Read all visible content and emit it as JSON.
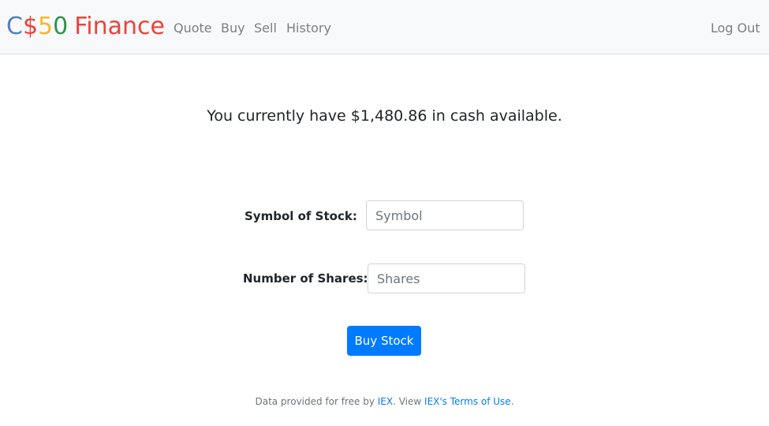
{
  "brand": {
    "c": "C",
    "dollar": "$",
    "five": "5",
    "zero": "0",
    "finance": "Finance"
  },
  "nav": {
    "quote": "Quote",
    "buy": "Buy",
    "sell": "Sell",
    "history": "History",
    "logout": "Log Out"
  },
  "cash_message": "You currently have $1,480.86 in cash available.",
  "form": {
    "symbol_label": "Symbol of Stock:",
    "symbol_placeholder": "Symbol",
    "symbol_value": "",
    "shares_label": "Number of Shares:",
    "shares_placeholder": "Shares",
    "shares_value": "",
    "submit_label": "Buy Stock"
  },
  "footer": {
    "prefix": "Data provided for free by ",
    "iex_link": "IEX",
    "middle": ". View ",
    "terms_link": "IEX's Terms of Use",
    "suffix": "."
  },
  "colors": {
    "navbar_bg": "#f8f9fa",
    "primary": "#007bff",
    "brand_blue": "#537fbe",
    "brand_red": "#ea433b",
    "brand_yellow": "#f5b82e",
    "brand_green": "#2e944b"
  }
}
